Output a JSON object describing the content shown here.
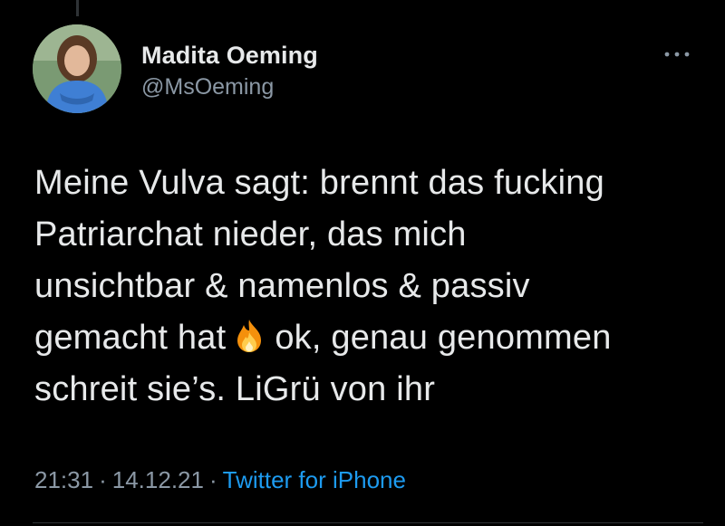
{
  "author": {
    "name": "Madita Oeming",
    "handle": "@MsOeming",
    "avatar_icon": "profile-photo"
  },
  "tweet": {
    "lines": [
      "Meine Vulva sagt: brennt das fucking",
      "Patriarchat nieder, das mich",
      "unsichtbar & namenlos & passiv",
      "ok, genau genommen",
      "schreit sie’s. LiGrü von ihr"
    ],
    "line4_prefix": "gemacht hat",
    "emoji": "fire-emoji"
  },
  "meta": {
    "time": "21:31",
    "date": "14.12.21",
    "separator": "·",
    "source": "Twitter for iPhone"
  },
  "colors": {
    "background": "#000000",
    "text": "#e7e9ea",
    "secondary": "#8b98a5",
    "link": "#1d9bf0"
  }
}
